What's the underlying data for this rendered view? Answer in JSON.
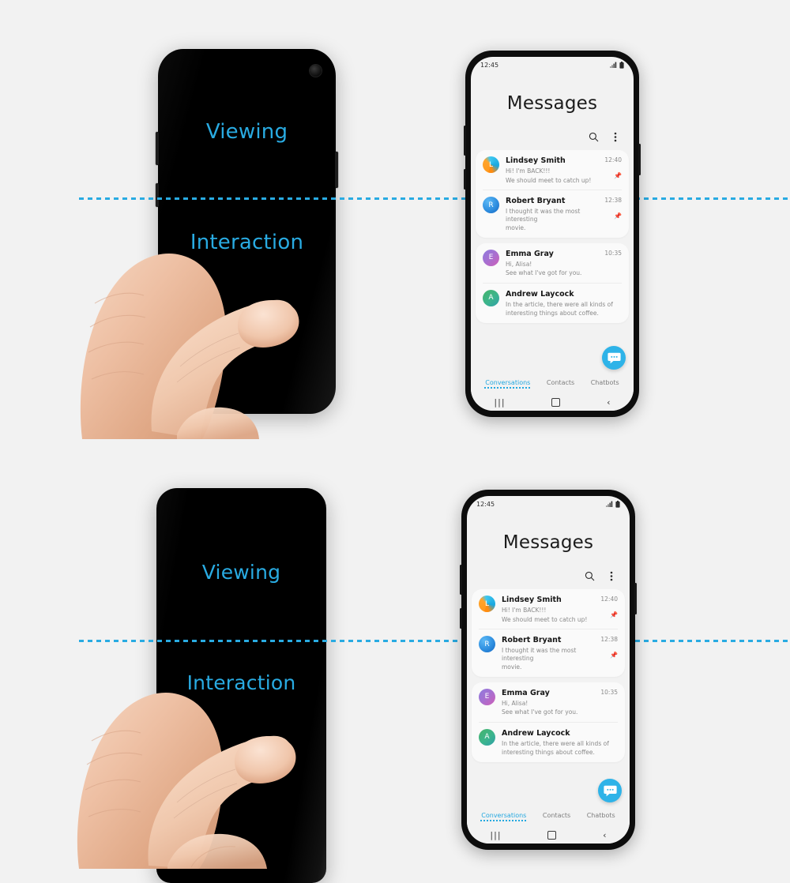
{
  "background_color": "#f2f2f2",
  "accent_color": "#29abe2",
  "panels": [
    {
      "id": "top",
      "left_phone": {
        "viewing_label": "Viewing",
        "interaction_label": "Interaction",
        "has_camera_punch_hole": true,
        "label_color": "#29abe2"
      }
    },
    {
      "id": "bottom",
      "left_phone": {
        "viewing_label": "Viewing",
        "interaction_label": "Interaction",
        "has_camera_punch_hole": false,
        "label_color": "#29abe2"
      }
    }
  ],
  "messages_app": {
    "status_bar": {
      "time": "12:45",
      "signal_icon": "signal-bars-icon",
      "battery_icon": "battery-icon"
    },
    "title": "Messages",
    "actions": [
      {
        "name": "search-icon",
        "label": "Search"
      },
      {
        "name": "more-options-icon",
        "label": "More options"
      }
    ],
    "fab": {
      "icon": "new-message-icon",
      "label": "New conversation"
    },
    "groups": [
      {
        "conversations": [
          {
            "avatar_letter": "L",
            "avatar_style": "av-l",
            "name": "Lindsey Smith",
            "preview_line1": "Hi! I'm BACK!!!",
            "preview_line2": "We should meet to catch up!",
            "time": "12:40",
            "pinned": true,
            "pin_icon": "pin-icon"
          },
          {
            "avatar_letter": "R",
            "avatar_style": "av-r",
            "name": "Robert Bryant",
            "preview_line1": "I thought it was the most interesting",
            "preview_line2": "movie.",
            "time": "12:38",
            "pinned": true,
            "pin_icon": "pin-icon"
          }
        ]
      },
      {
        "conversations": [
          {
            "avatar_letter": "E",
            "avatar_style": "av-e",
            "name": "Emma Gray",
            "preview_line1": "Hi, Alisa!",
            "preview_line2": "See what I've got for you.",
            "time": "10:35",
            "pinned": false,
            "pin_icon": ""
          },
          {
            "avatar_letter": "A",
            "avatar_style": "av-a",
            "name": "Andrew Laycock",
            "preview_line1": "In the article, there were all kinds of",
            "preview_line2": "interesting things about coffee.",
            "time": "",
            "pinned": false,
            "pin_icon": ""
          }
        ]
      }
    ],
    "tabs": [
      {
        "label": "Conversations",
        "active": true
      },
      {
        "label": "Contacts",
        "active": false
      },
      {
        "label": "Chatbots",
        "active": false
      }
    ],
    "nav_bar": [
      {
        "name": "recents-button",
        "glyph": "|||"
      },
      {
        "name": "home-button",
        "glyph": ""
      },
      {
        "name": "back-button",
        "glyph": "‹"
      }
    ]
  }
}
